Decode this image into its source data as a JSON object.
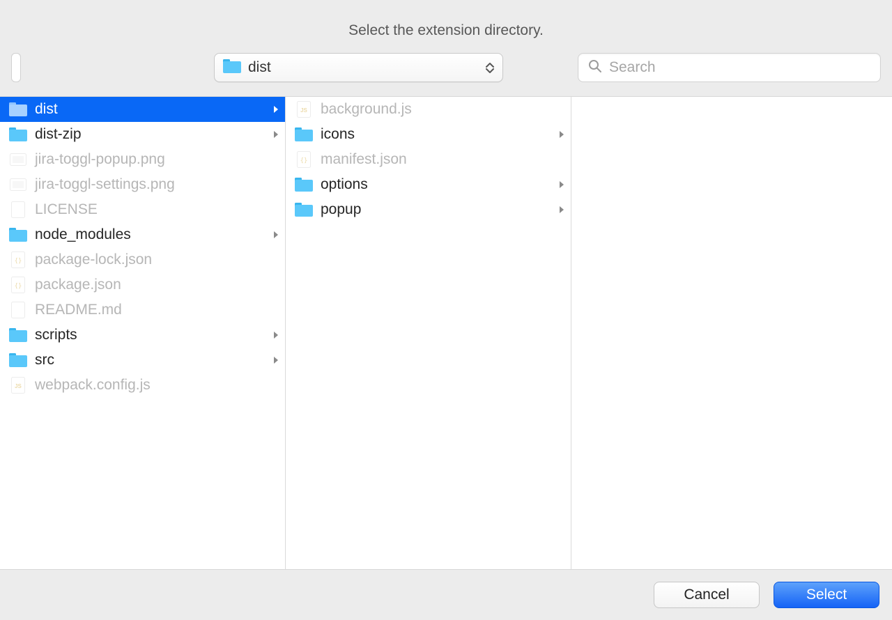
{
  "title": "Select the extension directory.",
  "path": {
    "label": "dist"
  },
  "search": {
    "placeholder": "Search"
  },
  "columns": [
    {
      "items": [
        {
          "name": "dist",
          "type": "folder",
          "dimmed": false,
          "hasChildren": true,
          "selected": true
        },
        {
          "name": "dist-zip",
          "type": "folder",
          "dimmed": false,
          "hasChildren": true,
          "selected": false
        },
        {
          "name": "jira-toggl-popup.png",
          "type": "image",
          "dimmed": true,
          "hasChildren": false,
          "selected": false
        },
        {
          "name": "jira-toggl-settings.png",
          "type": "image",
          "dimmed": true,
          "hasChildren": false,
          "selected": false
        },
        {
          "name": "LICENSE",
          "type": "file",
          "dimmed": true,
          "hasChildren": false,
          "selected": false
        },
        {
          "name": "node_modules",
          "type": "folder",
          "dimmed": false,
          "hasChildren": true,
          "selected": false
        },
        {
          "name": "package-lock.json",
          "type": "json",
          "dimmed": true,
          "hasChildren": false,
          "selected": false
        },
        {
          "name": "package.json",
          "type": "json",
          "dimmed": true,
          "hasChildren": false,
          "selected": false
        },
        {
          "name": "README.md",
          "type": "file",
          "dimmed": true,
          "hasChildren": false,
          "selected": false
        },
        {
          "name": "scripts",
          "type": "folder",
          "dimmed": false,
          "hasChildren": true,
          "selected": false
        },
        {
          "name": "src",
          "type": "folder",
          "dimmed": false,
          "hasChildren": true,
          "selected": false
        },
        {
          "name": "webpack.config.js",
          "type": "js",
          "dimmed": true,
          "hasChildren": false,
          "selected": false
        }
      ]
    },
    {
      "items": [
        {
          "name": "background.js",
          "type": "js",
          "dimmed": true,
          "hasChildren": false,
          "selected": false
        },
        {
          "name": "icons",
          "type": "folder",
          "dimmed": false,
          "hasChildren": true,
          "selected": false
        },
        {
          "name": "manifest.json",
          "type": "json",
          "dimmed": true,
          "hasChildren": false,
          "selected": false
        },
        {
          "name": "options",
          "type": "folder",
          "dimmed": false,
          "hasChildren": true,
          "selected": false
        },
        {
          "name": "popup",
          "type": "folder",
          "dimmed": false,
          "hasChildren": true,
          "selected": false
        }
      ]
    },
    {
      "items": []
    }
  ],
  "buttons": {
    "cancel": "Cancel",
    "select": "Select"
  }
}
